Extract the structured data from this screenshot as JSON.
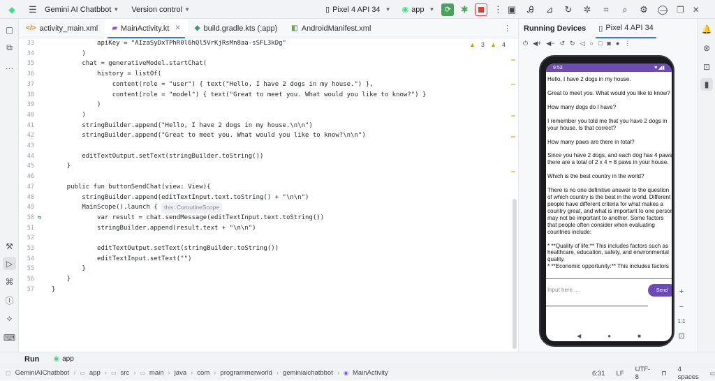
{
  "topbar": {
    "project": "Gemini AI Chatbbot",
    "vcs": "Version control",
    "device": "Pixel 4 API 34",
    "run_config": "app"
  },
  "tabs": [
    {
      "label": "activity_main.xml",
      "icon": "xml-file-icon"
    },
    {
      "label": "MainActivity.kt",
      "icon": "kotlin-file-icon"
    },
    {
      "label": "build.gradle.kts (:app)",
      "icon": "gradle-file-icon"
    },
    {
      "label": "AndroidManifest.xml",
      "icon": "manifest-file-icon"
    }
  ],
  "editor": {
    "warnings": "3",
    "weak_warnings": "4",
    "lines": [
      {
        "n": "33",
        "t": "            apiKey = \"AIzaSyDxTPhR0l6hQl5VrKjRsMn8aa-sSFL3kDg\""
      },
      {
        "n": "34",
        "t": "        )"
      },
      {
        "n": "35",
        "t": "        chat = generativeModel.startChat("
      },
      {
        "n": "36",
        "t": "            history = listOf("
      },
      {
        "n": "37",
        "t": "                content(role = \"user\") { text(\"Hello, I have 2 dogs in my house.\") },"
      },
      {
        "n": "38",
        "t": "                content(role = \"model\") { text(\"Great to meet you. What would you like to know?\") }"
      },
      {
        "n": "39",
        "t": "            )"
      },
      {
        "n": "40",
        "t": "        )"
      },
      {
        "n": "41",
        "t": "        stringBuilder.append(\"Hello, I have 2 dogs in my house.\\n\\n\")"
      },
      {
        "n": "42",
        "t": "        stringBuilder.append(\"Great to meet you. What would you like to know?\\n\\n\")"
      },
      {
        "n": "43",
        "t": ""
      },
      {
        "n": "44",
        "t": "        editTextOutput.setText(stringBuilder.toString())"
      },
      {
        "n": "45",
        "t": "    }"
      },
      {
        "n": "46",
        "t": ""
      },
      {
        "n": "47",
        "t": "    public fun buttonSendChat(view: View){"
      },
      {
        "n": "48",
        "t": "        stringBuilder.append(editTextInput.text.toString() + \"\\n\\n\")"
      },
      {
        "n": "49",
        "t": "        MainScope().launch {"
      },
      {
        "n": "50",
        "t": "            var result = chat.sendMessage(editTextInput.text.toString())"
      },
      {
        "n": "51",
        "t": "            stringBuilder.append(result.text + \"\\n\\n\")"
      },
      {
        "n": "52",
        "t": ""
      },
      {
        "n": "53",
        "t": "            editTextOutput.setText(stringBuilder.toString())"
      },
      {
        "n": "54",
        "t": "            editTextInput.setText(\"\")"
      },
      {
        "n": "55",
        "t": "        }"
      },
      {
        "n": "56",
        "t": "    }"
      },
      {
        "n": "57",
        "t": "}"
      }
    ],
    "hint": "this: CoroutineScope"
  },
  "devices": {
    "title": "Running Devices",
    "tab": "Pixel 4 API 34",
    "time": "9:53",
    "chat": [
      "Hello, I have 2 dogs in my house.",
      "Great to meet you. What would you like to know?",
      "How many dogs do I have?",
      "I remember you told me that you have 2 dogs in\nyour house. Is that correct?",
      "How many paws are there in total?",
      "Since you have 2 dogs, and each dog has 4 paws,\nthere are a total of 2 x 4 = 8 paws in your house.",
      "Which is the best country in the world?",
      "There is no one definitive answer to the question\nof which country is the best in the world. Different\npeople have different criteria for what makes a\ncountry great, and what is important to one person\nmay not be important to another. Some factors\nthat people often consider when evaluating\ncountries include:",
      "* **Quality of life:** This includes factors such as\nhealthcare, education, safety, and environmental\nquality.\n* **Economic opportunity:** This includes factors"
    ],
    "input_placeholder": "Input here ...",
    "send_label": "Send",
    "zoom_label": "1:1"
  },
  "runbar": {
    "label": "Run",
    "app": "app"
  },
  "status": {
    "crumbs": [
      "GeminiAIChatbbot",
      "app",
      "src",
      "main",
      "java",
      "com",
      "programmerworld",
      "geminiaichatbbot",
      "MainActivity"
    ],
    "position": "6:31",
    "line_sep": "LF",
    "encoding": "UTF-8",
    "indent": "4 spaces"
  }
}
